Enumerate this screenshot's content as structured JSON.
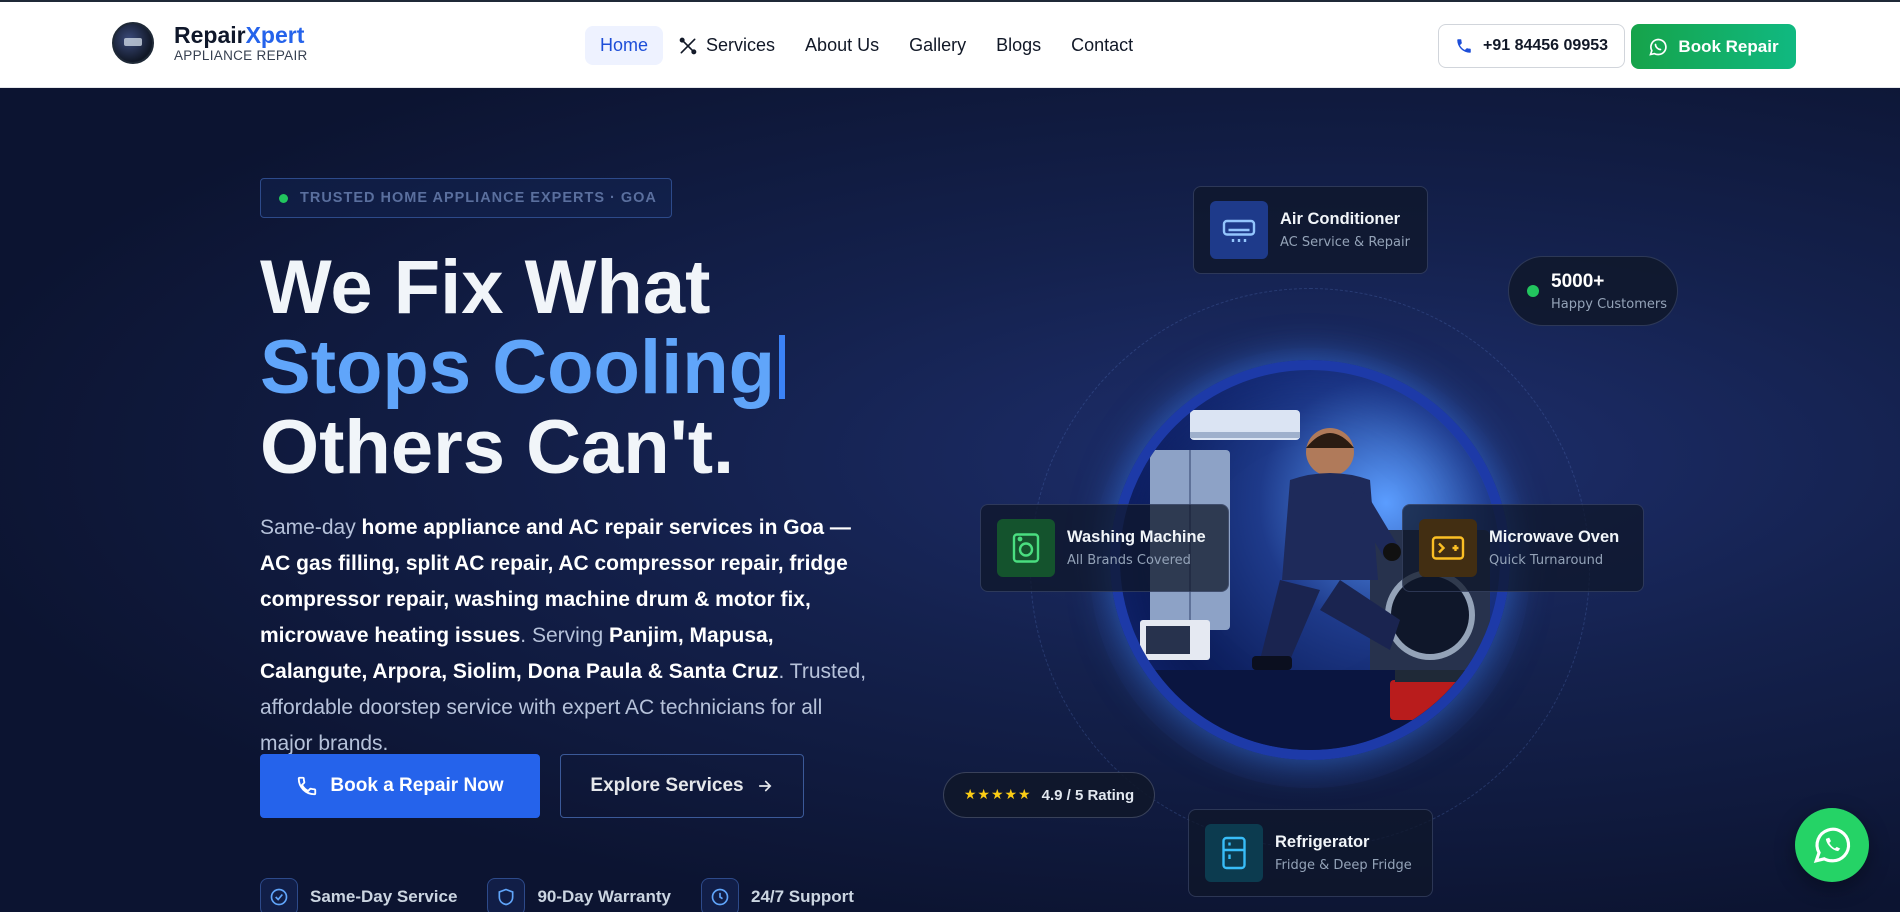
{
  "header": {
    "logo": {
      "brand_main": "Repair",
      "brand_accent": "Xpert",
      "subtitle": "APPLIANCE REPAIR"
    },
    "nav": [
      {
        "label": "Home",
        "active": true
      },
      {
        "label": "Services",
        "icon": "tools-icon"
      },
      {
        "label": "About Us"
      },
      {
        "label": "Gallery"
      },
      {
        "label": "Blogs"
      },
      {
        "label": "Contact"
      }
    ],
    "phone": "+91 84456 09953",
    "book_label": "Book Repair"
  },
  "hero": {
    "badge": "TRUSTED HOME APPLIANCE EXPERTS · GOA",
    "headline": {
      "line1": "We Fix What",
      "line2": "Stops Cooling",
      "line3": "Others Can't."
    },
    "description": {
      "p1": "Same-day ",
      "b1": "home appliance and AC repair services in Goa — AC gas filling, split AC repair, AC compressor repair, fridge compressor repair, washing machine drum & motor fix, microwave heating issues",
      "p2": ". Serving ",
      "b2": "Panjim, Mapusa, Calangute, Arpora, Siolim, Dona Paula & Santa Cruz",
      "p3": ". Trusted, affordable doorstep service with expert AC technicians for all major brands."
    },
    "primary_cta": "Book a Repair Now",
    "secondary_cta": "Explore Services",
    "features": [
      {
        "label": "Same-Day Service",
        "icon": "check-circle-icon"
      },
      {
        "label": "90-Day Warranty",
        "icon": "shield-icon"
      },
      {
        "label": "24/7 Support",
        "icon": "clock-icon"
      }
    ]
  },
  "visual": {
    "cards": {
      "ac": {
        "title": "Air Conditioner",
        "sub": "AC Service & Repair"
      },
      "washer": {
        "title": "Washing Machine",
        "sub": "All Brands Covered"
      },
      "microwave": {
        "title": "Microwave Oven",
        "sub": "Quick Turnaround"
      },
      "fridge": {
        "title": "Refrigerator",
        "sub": "Fridge & Deep Fridge"
      }
    },
    "stat": {
      "num": "5000+",
      "label": "Happy Customers"
    },
    "rating": {
      "stars": "★★★★★",
      "text": "4.9 / 5 Rating"
    }
  },
  "colors": {
    "accent": "#2563eb",
    "green": "#22c55e",
    "whatsapp": "#25d366"
  }
}
